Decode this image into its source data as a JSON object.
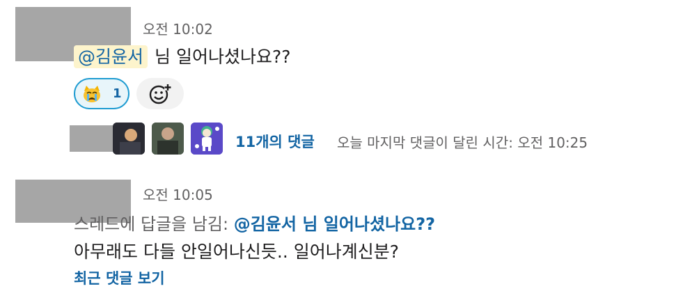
{
  "message_1": {
    "timestamp": "오전 10:02",
    "mention": "@김윤서",
    "text": "님 일어나셨나요??",
    "reactions": [
      {
        "emoji": "crying-cat-emoji",
        "count": "1"
      }
    ],
    "add_reaction_icon": "add-reaction-icon",
    "thread": {
      "reply_count": "11개의 댓글",
      "last_reply": "오늘 마지막 댓글이 달린 시간: 오전 10:25"
    }
  },
  "message_2": {
    "timestamp": "오전 10:05",
    "thread_prefix": "스레드에 답글을 남김:",
    "thread_parent": "@김윤서 님 일어나셨나요??",
    "text": "아무래도 다들 안일어나신듯.. 일어나계신분?",
    "view_latest": "최근 댓글 보기"
  },
  "colors": {
    "link": "#1264a3",
    "mention_bg": "#fdf4cc",
    "reaction_border": "#1d9bd1",
    "reaction_bg": "#e8f5fa",
    "muted": "#616061"
  }
}
